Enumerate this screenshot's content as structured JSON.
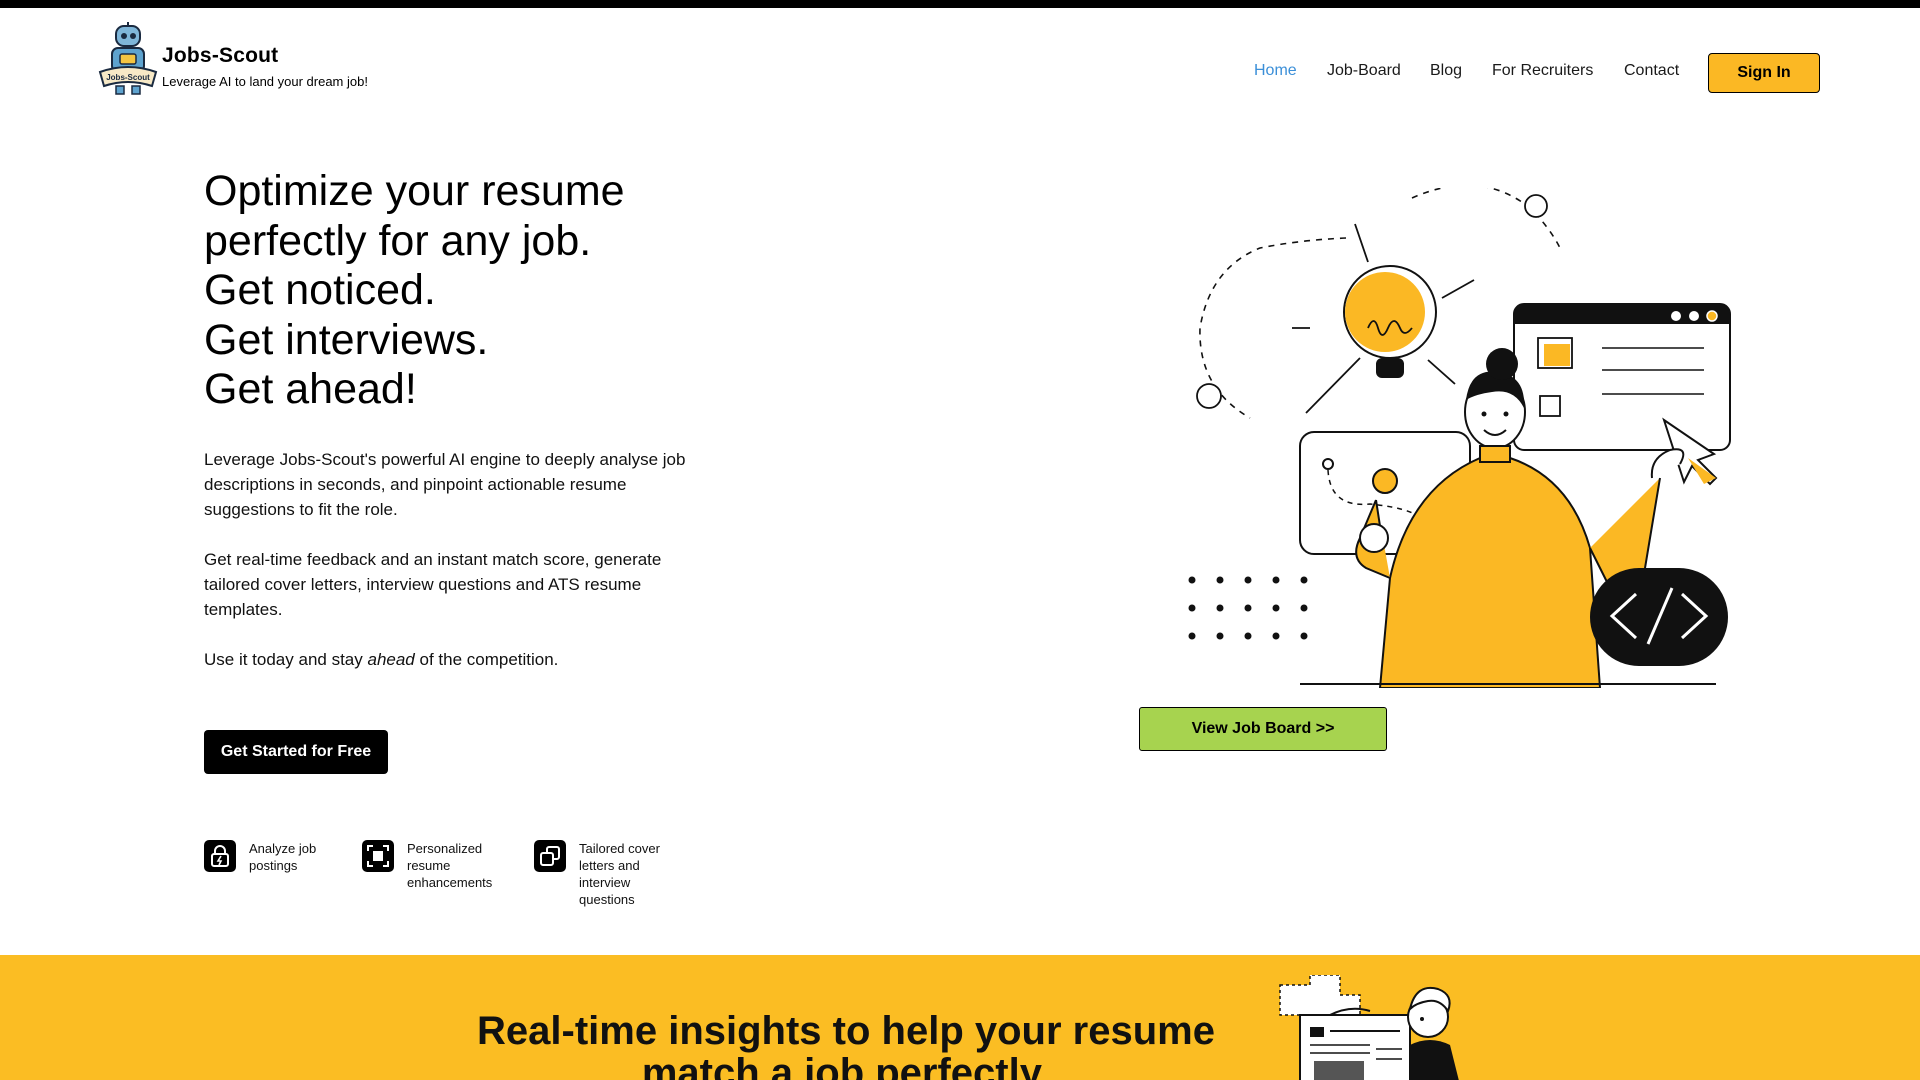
{
  "header": {
    "brand_name": "Jobs-Scout",
    "tagline": "Leverage AI to land your dream job!",
    "logo_badge": "Jobs-Scout",
    "nav": [
      {
        "label": "Home",
        "active": true
      },
      {
        "label": "Job-Board",
        "active": false
      },
      {
        "label": "Blog",
        "active": false
      },
      {
        "label": "For Recruiters",
        "active": false
      },
      {
        "label": "Contact",
        "active": false
      }
    ],
    "signin_label": "Sign In"
  },
  "hero": {
    "title_lines": [
      "Optimize your resume",
      "perfectly for any job.",
      "Get noticed.",
      "Get interviews.",
      "Get ahead!"
    ],
    "para1": "Leverage Jobs-Scout's powerful AI engine to deeply analyse job descriptions in seconds, and pinpoint actionable resume suggestions to fit the role.",
    "para2": "Get real-time feedback and an instant match score, generate tailored cover letters, interview questions and ATS resume templates.",
    "para3_before": "Use it today and stay ",
    "para3_em": "ahead",
    "para3_after": " of the competition.",
    "cta_label": "Get Started for Free",
    "features": [
      {
        "icon": "lock-bolt-icon",
        "label": "Analyze job postings"
      },
      {
        "icon": "frame-square-icon",
        "label": "Personalized resume enhancements"
      },
      {
        "icon": "copy-squares-icon",
        "label": "Tailored cover letters and interview questions"
      }
    ],
    "view_board_label": "View Job Board >>"
  },
  "band": {
    "title_lines": [
      "Real-time insights to help your resume",
      "match a job perfectly."
    ]
  },
  "colors": {
    "accent_yellow": "#fbbd23",
    "nav_active": "#3b8fd8",
    "button_green": "#a7d34f",
    "dark": "#000000"
  }
}
